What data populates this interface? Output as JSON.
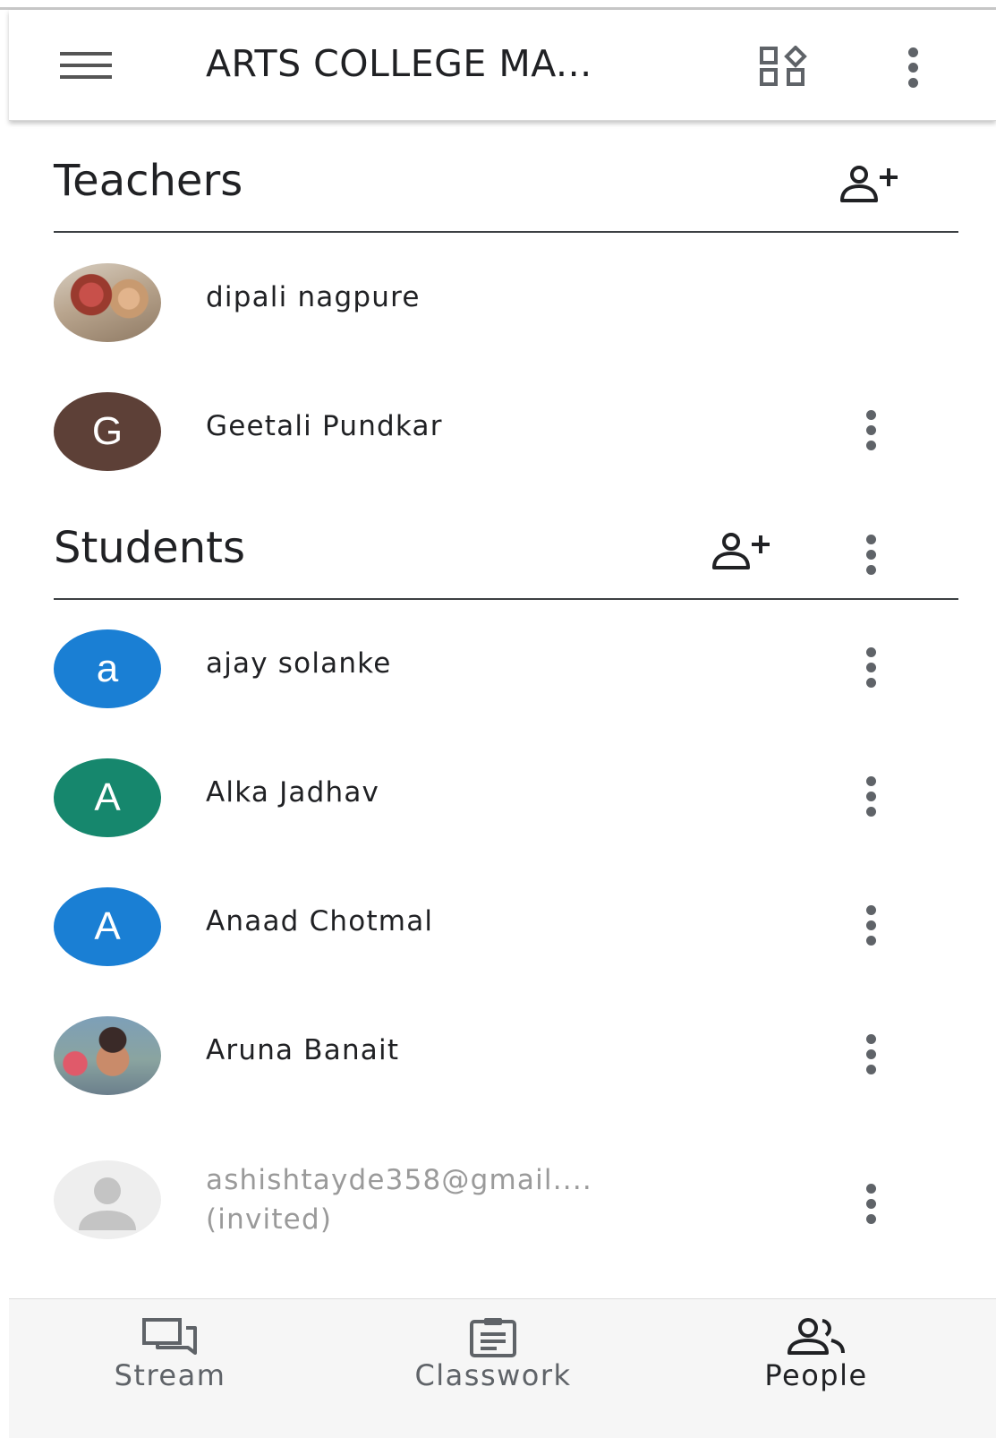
{
  "app_bar": {
    "title": "ARTS COLLEGE MA...",
    "menu_icon": "hamburger-menu-icon",
    "apps_icon": "apps-shapes-icon",
    "overflow_icon": "more-vert-icon"
  },
  "teachers": {
    "title": "Teachers",
    "add_icon": "person-add-icon",
    "items": [
      {
        "name": "dipali nagpure",
        "avatar_type": "photo",
        "has_menu": false
      },
      {
        "name": "Geetali Pundkar",
        "avatar_letter": "G",
        "avatar_color": "#5d4037",
        "has_menu": true
      }
    ]
  },
  "students": {
    "title": "Students",
    "add_icon": "person-add-icon",
    "items": [
      {
        "name": "ajay solanke",
        "avatar_letter": "a",
        "avatar_color": "#1a7fd4"
      },
      {
        "name": "Alka Jadhav",
        "avatar_letter": "A",
        "avatar_color": "#16876d"
      },
      {
        "name": "Anaad Chotmal",
        "avatar_letter": "A",
        "avatar_color": "#1a7fd4"
      },
      {
        "name": "Aruna Banait",
        "avatar_type": "photo"
      },
      {
        "name": "ashishtayde358@gmail....",
        "status": "(invited)",
        "avatar_type": "placeholder"
      }
    ]
  },
  "bottom_nav": [
    {
      "label": "Stream",
      "icon": "stream-icon",
      "active": false
    },
    {
      "label": "Classwork",
      "icon": "classwork-icon",
      "active": false
    },
    {
      "label": "People",
      "icon": "people-icon",
      "active": true
    }
  ],
  "colors": {
    "text_primary": "#202124",
    "text_secondary": "#5f6368",
    "invited_text": "#9a9a9a",
    "nav_background": "#f6f6f6"
  }
}
